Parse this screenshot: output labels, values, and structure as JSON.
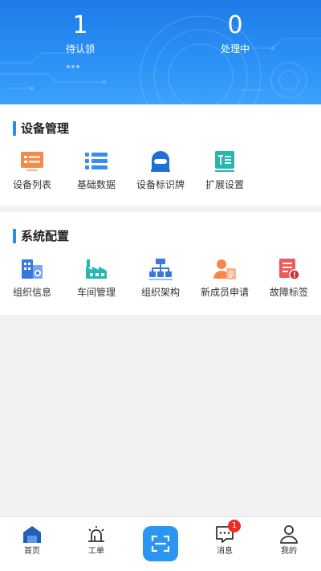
{
  "header": {
    "pending": {
      "count": "1",
      "label": "待认领"
    },
    "processing": {
      "count": "0",
      "label": "处理中"
    }
  },
  "device_management": {
    "title": "设备管理",
    "items": [
      {
        "label": "设备列表",
        "icon": "device-list-icon"
      },
      {
        "label": "基础数据",
        "icon": "list-icon"
      },
      {
        "label": "设备标识牌",
        "icon": "id-tag-icon"
      },
      {
        "label": "扩展设置",
        "icon": "extension-settings-icon"
      }
    ]
  },
  "system_config": {
    "title": "系统配置",
    "items": [
      {
        "label": "组织信息",
        "icon": "organization-icon"
      },
      {
        "label": "车间管理",
        "icon": "factory-icon"
      },
      {
        "label": "组织架构",
        "icon": "org-chart-icon"
      },
      {
        "label": "新成员申请",
        "icon": "new-member-icon"
      },
      {
        "label": "故障标签",
        "icon": "fault-tag-icon"
      }
    ]
  },
  "tabbar": {
    "items": [
      {
        "label": "首页",
        "icon": "home-icon"
      },
      {
        "label": "工单",
        "icon": "alarm-light-icon"
      },
      {
        "label": "",
        "icon": "scan-icon"
      },
      {
        "label": "消息",
        "icon": "message-icon",
        "badge": "1"
      },
      {
        "label": "我的",
        "icon": "user-icon"
      }
    ]
  },
  "colors": {
    "accent": "#2a8cf0",
    "header_top": "#1e7be8",
    "badge": "#f02a2a"
  }
}
